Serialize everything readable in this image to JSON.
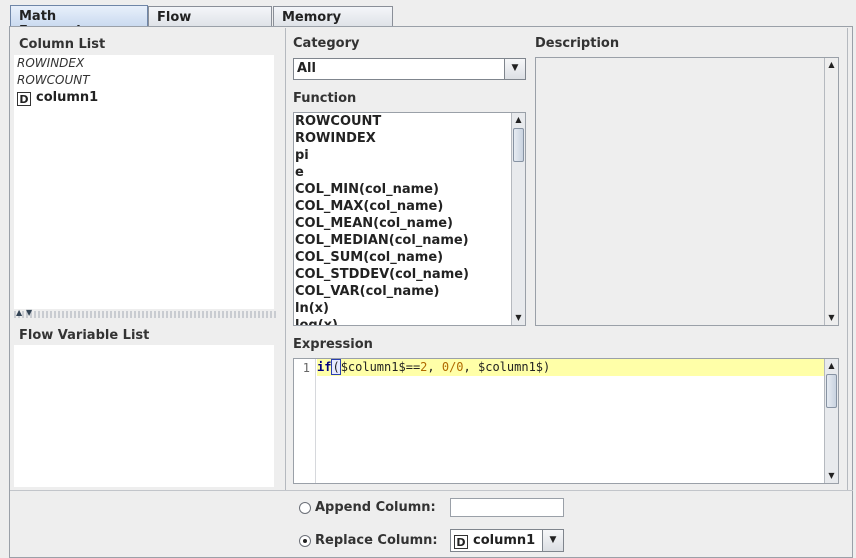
{
  "tabs": [
    "Math Expression",
    "Flow Variables",
    "Memory Policy"
  ],
  "column_list": {
    "title": "Column List",
    "items": [
      {
        "label": "ROWINDEX",
        "type": ""
      },
      {
        "label": "ROWCOUNT",
        "type": ""
      },
      {
        "label": "column1",
        "type": "D"
      }
    ]
  },
  "flow_variable_list": {
    "title": "Flow Variable List"
  },
  "category": {
    "label": "Category",
    "value": "All"
  },
  "function": {
    "label": "Function",
    "items": [
      "ROWCOUNT",
      "ROWINDEX",
      "pi",
      "e",
      "COL_MIN(col_name)",
      "COL_MAX(col_name)",
      "COL_MEAN(col_name)",
      "COL_MEDIAN(col_name)",
      "COL_SUM(col_name)",
      "COL_STDDEV(col_name)",
      "COL_VAR(col_name)",
      "ln(x)",
      "log(x)"
    ]
  },
  "description": {
    "label": "Description"
  },
  "expression": {
    "label": "Expression",
    "line_number": "1",
    "tokens": {
      "kw": "if",
      "open": "(",
      "col1": "$column1$",
      "op": "==",
      "num": "2",
      "sep1": ", ",
      "div": "0/0",
      "sep2": ", ",
      "col2": "$column1$",
      "close": ")"
    }
  },
  "append_column": {
    "label": "Append Column:",
    "value": "",
    "selected": false
  },
  "replace_column": {
    "label": "Replace Column:",
    "value": "column1",
    "type": "D",
    "selected": true
  },
  "colors": {
    "highlight": "#ffffa8",
    "number": "#b06a00",
    "tab_active": "#c9d9ef"
  }
}
